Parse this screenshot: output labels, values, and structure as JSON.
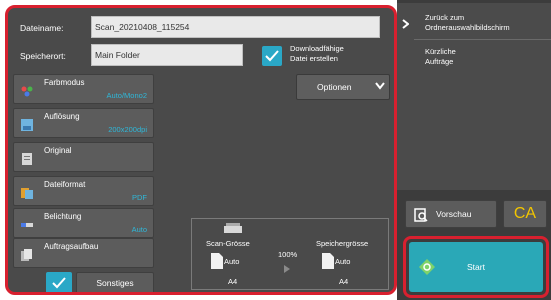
{
  "filename": {
    "label": "Dateiname:",
    "value": "Scan_20210408_115254"
  },
  "location": {
    "label": "Speicherort:",
    "value": "Main Folder"
  },
  "download": {
    "label_line1": "Downloadfähige",
    "label_line2": "Datei erstellen",
    "checked": true
  },
  "options": {
    "label": "Optionen"
  },
  "settings": [
    {
      "label": "Farbmodus",
      "value": "Auto/Mono2",
      "icon": "color-mode-icon"
    },
    {
      "label": "Auflösung",
      "value": "200x200dpi",
      "icon": "resolution-icon"
    },
    {
      "label": "Original",
      "value": "",
      "icon": "original-icon"
    },
    {
      "label": "Dateiformat",
      "value": "PDF",
      "icon": "file-format-icon"
    },
    {
      "label": "Belichtung",
      "value": "Auto",
      "icon": "exposure-icon"
    },
    {
      "label": "Auftragsaufbau",
      "value": "",
      "icon": "job-build-icon"
    }
  ],
  "others": {
    "label": "Sonstiges"
  },
  "size_preview": {
    "scan_label": "Scan-Grösse",
    "scan_value": "Auto",
    "scan_paper": "A4",
    "ratio": "100%",
    "store_label": "Speichergrösse",
    "store_value": "Auto",
    "store_paper": "A4"
  },
  "right": {
    "back_line1": "Zurück zum",
    "back_line2": "Ordnerauswahlbildschirm",
    "recent_line1": "Kürzliche",
    "recent_line2": "Aufträge"
  },
  "actions": {
    "preview": "Vorschau",
    "ca": "CA",
    "start": "Start"
  },
  "colors": {
    "accent": "#2aa8c7",
    "highlight": "#d8202f",
    "ca": "#f2c500"
  }
}
